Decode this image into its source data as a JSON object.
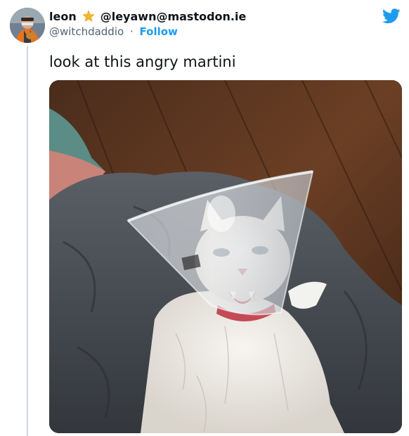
{
  "author": {
    "display_name": "leon",
    "name_emoji": "star",
    "alt_handle": "@leyawn@mastodon.ie",
    "handle": "@witchdaddio",
    "separator": "·",
    "follow_label": "Follow"
  },
  "tweet": {
    "text": "look at this angry martini"
  },
  "icons": {
    "brand": "twitter-bird-icon",
    "brand_color": "#1d9bf0"
  },
  "media": {
    "kind": "photo",
    "subject": "white cat wearing a clear plastic cone collar"
  }
}
